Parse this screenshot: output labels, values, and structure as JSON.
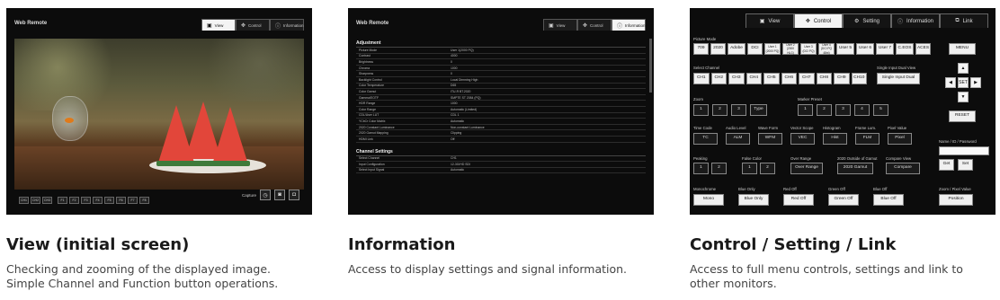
{
  "cards": [
    {
      "heading": "View (initial screen)",
      "desc": [
        "Checking and zooming of the displayed image.",
        "Simple Channel and Function button operations."
      ]
    },
    {
      "heading": "Information",
      "desc": [
        "Access to display settings and signal information."
      ]
    },
    {
      "heading": "Control / Setting / Link",
      "desc": [
        "Access to full menu controls, settings and link to",
        "other monitors."
      ]
    }
  ],
  "view_shot": {
    "app_title": "Web Remote",
    "tabs": [
      {
        "label": "View",
        "icon": "view-icon",
        "active": true
      },
      {
        "label": "Control",
        "icon": "move-icon",
        "active": false
      },
      {
        "label": "Information",
        "icon": "info-icon",
        "active": false
      }
    ],
    "buttons": [
      "CH1",
      "CH2",
      "CH3",
      "F1",
      "F2",
      "F3",
      "F4",
      "F5",
      "F6",
      "F7",
      "F8"
    ],
    "capture_label": "Capture"
  },
  "info_shot": {
    "app_title": "Web Remote",
    "tabs": [
      {
        "label": "View",
        "active": false
      },
      {
        "label": "Control",
        "active": false
      },
      {
        "label": "Information",
        "active": true
      }
    ],
    "sections": [
      {
        "title": "Adjustment",
        "rows": [
          [
            "Picture Mode",
            "User 1(2000 PQ)"
          ],
          [
            "Contrast",
            "4000"
          ],
          [
            "Brightness",
            "0"
          ],
          [
            "Chroma",
            "1000"
          ],
          [
            "Sharpness",
            "0"
          ],
          [
            "Backlight Control",
            "Local Dimming High"
          ],
          [
            "Color Temperature",
            "D65"
          ],
          [
            "Color Gamut",
            "ITU-R BT.2020"
          ],
          [
            "Gamma/EOTF",
            "SMPTE ST 2084 (PQ)"
          ],
          [
            "HDR Range",
            "1000"
          ],
          [
            "Color Range",
            "Automatic (Limited)"
          ],
          [
            "CDL/User LUT",
            "CDL 1"
          ],
          [
            "YCbCr Color Matrix",
            "Automatic"
          ],
          [
            "2020 Constant Luminance",
            "Non-constant Luminance"
          ],
          [
            "2020 Gamut Mapping",
            "Clipping"
          ],
          [
            "HDMI Link",
            "Off"
          ]
        ]
      },
      {
        "title": "Channel Settings",
        "rows": [
          [
            "Select Channel",
            "CH1"
          ],
          [
            "Input Configuration",
            "12-3G/HD SDI"
          ],
          [
            "Select Input Signal",
            "Automatic"
          ]
        ]
      }
    ]
  },
  "control_shot": {
    "tabs": [
      {
        "label": "View",
        "active": false
      },
      {
        "label": "Control",
        "active": true
      },
      {
        "label": "Setting",
        "active": false
      },
      {
        "label": "Information",
        "active": false
      },
      {
        "label": "Link",
        "active": false
      }
    ],
    "picture_mode_label": "Picture Mode",
    "picture_modes": [
      "709",
      "2020",
      "Adobe",
      "DCI",
      "User 1 (2000 PQ)",
      "User 2 (2000 HLG)",
      "User 3 (DCI PQ)",
      "User 4 (DCI PQ 48nt)",
      "User 5",
      "User 6",
      "User 7",
      "C.EOS",
      "ACES"
    ],
    "menu_label": "MENU",
    "select_channel_label": "Select Channel",
    "channels": [
      "CH1",
      "CH2",
      "CH3",
      "CH4",
      "CH5",
      "CH6",
      "CH7",
      "CH8",
      "CH9",
      "CH10"
    ],
    "dual_view_label": "Single Input Dual View",
    "dual_view_button": "Single Input Dual",
    "set_label": "SET",
    "reset_label": "RESET",
    "zoom_label": "Zoom",
    "zoom_buttons": [
      "1",
      "2",
      "3",
      "Type"
    ],
    "marker_label": "Marker Preset",
    "marker_buttons": [
      "1",
      "2",
      "3",
      "4",
      "5"
    ],
    "func_labels": [
      "Time Code",
      "Audio Level",
      "Wave Form",
      "Vector Scope",
      "Histogram",
      "Frame Lum.",
      "Pixel Value"
    ],
    "func_buttons": [
      "TC",
      "ALM",
      "WFM",
      "VEC",
      "Hist",
      "FLM",
      "Pixel"
    ],
    "name_label": "Name / ID / Password",
    "get_label": "Get",
    "set_btn_label": "Set",
    "peaking_label": "Peaking",
    "peaking_buttons": [
      "1",
      "2"
    ],
    "false_color_label": "False Color",
    "false_color_buttons": [
      "1",
      "2"
    ],
    "over_range_label": "Over Range",
    "over_range_button": "Over Range",
    "gamut_label": "2020 Outside of Gamut",
    "gamut_button": "2020 Gamut",
    "compare_label": "Compare View",
    "compare_button": "Compare",
    "mono_labels": [
      "Monochrome",
      "Blue Only",
      "Red Off",
      "Green Off",
      "Blue Off"
    ],
    "mono_buttons": [
      "Mono",
      "Blue Only",
      "Red Off",
      "Green Off",
      "Blue Off"
    ],
    "zoom_pixel_label": "Zoom / Pixel Value",
    "position_button": "Position"
  }
}
